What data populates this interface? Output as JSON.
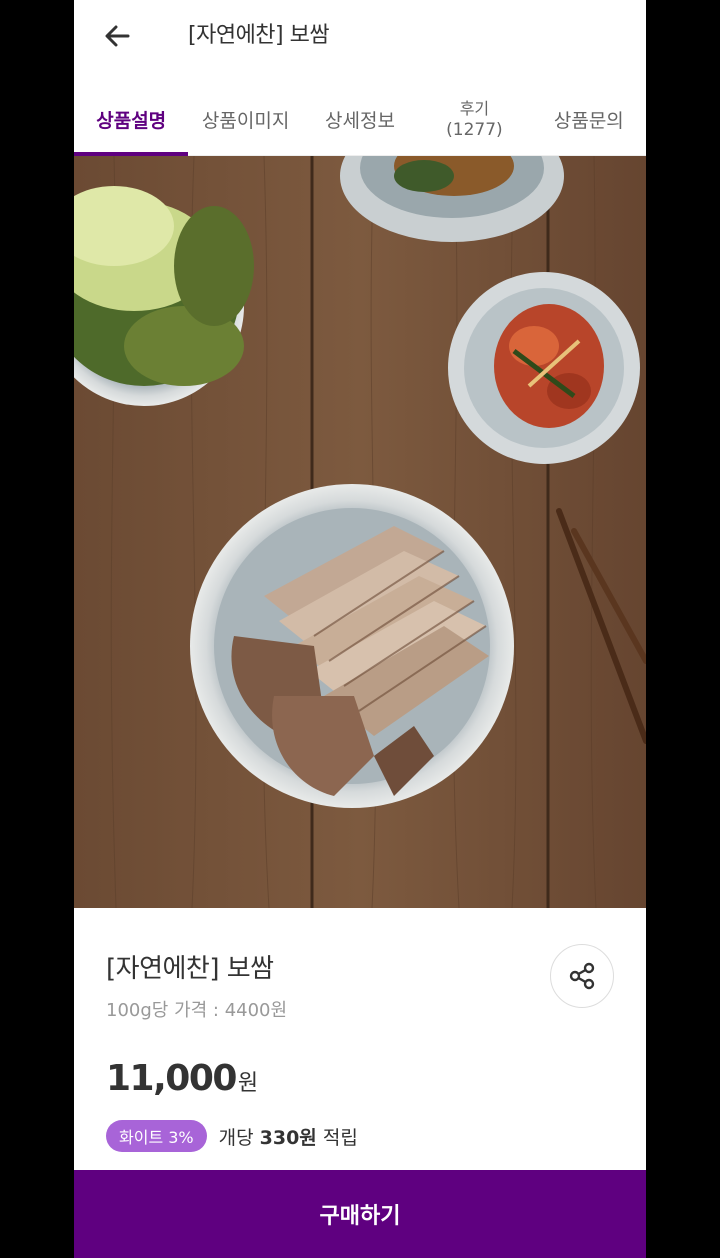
{
  "header": {
    "title": "[자연에찬] 보쌈",
    "back_icon": "arrow-left-icon"
  },
  "tabs": [
    {
      "label": "상품설명",
      "active": true
    },
    {
      "label": "상품이미지",
      "active": false
    },
    {
      "label": "상세정보",
      "active": false
    },
    {
      "label": "후기",
      "count": "(1277)",
      "active": false
    },
    {
      "label": "상품문의",
      "active": false
    }
  ],
  "product": {
    "name": "[자연에찬] 보쌈",
    "unit_price": "100g당 가격 : 4400원",
    "price": "11,000",
    "price_unit": "원",
    "badge": "화이트 3%",
    "point_prefix": "개당 ",
    "point_amount": "330원",
    "point_suffix": " 적립"
  },
  "buy_button": {
    "label": "구매하기"
  },
  "colors": {
    "brand": "#5f0080",
    "badge": "#a864d8"
  }
}
